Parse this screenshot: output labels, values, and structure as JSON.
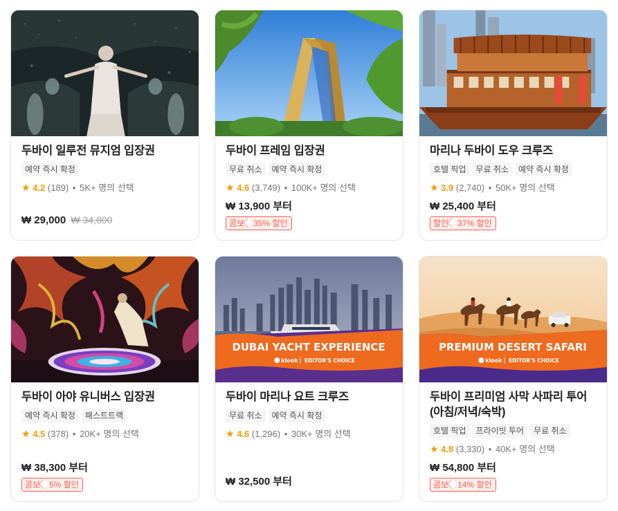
{
  "cards": [
    {
      "title": "두바이 일루전 뮤지엄 입장권",
      "tags": [
        "예약 즉시 확정"
      ],
      "rating": {
        "score": "4.2",
        "reviews": "(189)",
        "booked": "5K+ 명의 선택"
      },
      "price": "₩ 29,000",
      "old_price": "₩ 34,800",
      "image": "dark-illusion-museum-photo"
    },
    {
      "title": "두바이 프레임 입장권",
      "tags": [
        "무료 취소",
        "예약 즉시 확정"
      ],
      "rating": {
        "score": "4.6",
        "reviews": "(3,749)",
        "booked": "100K+ 명의 선택"
      },
      "price": "₩ 13,900 부터",
      "promo": {
        "kind": "콤보",
        "discount": "35% 할인"
      },
      "image": "dubai-frame-photo"
    },
    {
      "title": "마리나 두바이 도우 크루즈",
      "tags": [
        "호텔 픽업",
        "무료 취소",
        "예약 즉시 확정"
      ],
      "rating": {
        "score": "3.9",
        "reviews": "(2,740)",
        "booked": "50K+ 명의 선택"
      },
      "price": "₩ 25,400 부터",
      "promo": {
        "kind": "할인",
        "discount": "37% 할인"
      },
      "image": "dhow-cruise-photo"
    },
    {
      "title": "두바이 아야 유니버스 입장권",
      "tags": [
        "예약 즉시 확정",
        "패스트트랙"
      ],
      "rating": {
        "score": "4.5",
        "reviews": "(378)",
        "booked": "20K+ 명의 선택"
      },
      "price": "₩ 38,300 부터",
      "promo": {
        "kind": "콤보",
        "discount": "5% 할인"
      },
      "image": "aya-universe-photo"
    },
    {
      "title": "두바이 마리나 요트 크루즈",
      "tags": [
        "무료 취소",
        "예약 즉시 확정"
      ],
      "rating": {
        "score": "4.6",
        "reviews": "(1,296)",
        "booked": "30K+ 명의 선택"
      },
      "price": "₩ 32,500 부터",
      "image": "yacht-photo",
      "banner": {
        "headline": "DUBAI YACHT EXPERIENCE",
        "brand": "klook",
        "badge": "EDITOR'S CHOICE"
      }
    },
    {
      "title": "두바이 프리미엄 사막 사파리 투어 (아침/저녁/숙박)",
      "tags": [
        "호텔 픽업",
        "프라이빗 투어",
        "무료 취소"
      ],
      "rating": {
        "score": "4.8",
        "reviews": "(3,330)",
        "booked": "40K+ 명의 선택"
      },
      "price": "₩ 54,800 부터",
      "promo": {
        "kind": "콤보",
        "discount": "14% 할인"
      },
      "image": "desert-safari-photo",
      "banner": {
        "headline": "PREMIUM DESERT SAFARI",
        "brand": "klook",
        "badge": "EDITOR'S CHOICE"
      }
    }
  ],
  "colors": {
    "accent": "#f09b0a",
    "promo": "#ff5b4d",
    "banner_orange": "#ee6a1f",
    "banner_purple": "#4a2a8a"
  }
}
